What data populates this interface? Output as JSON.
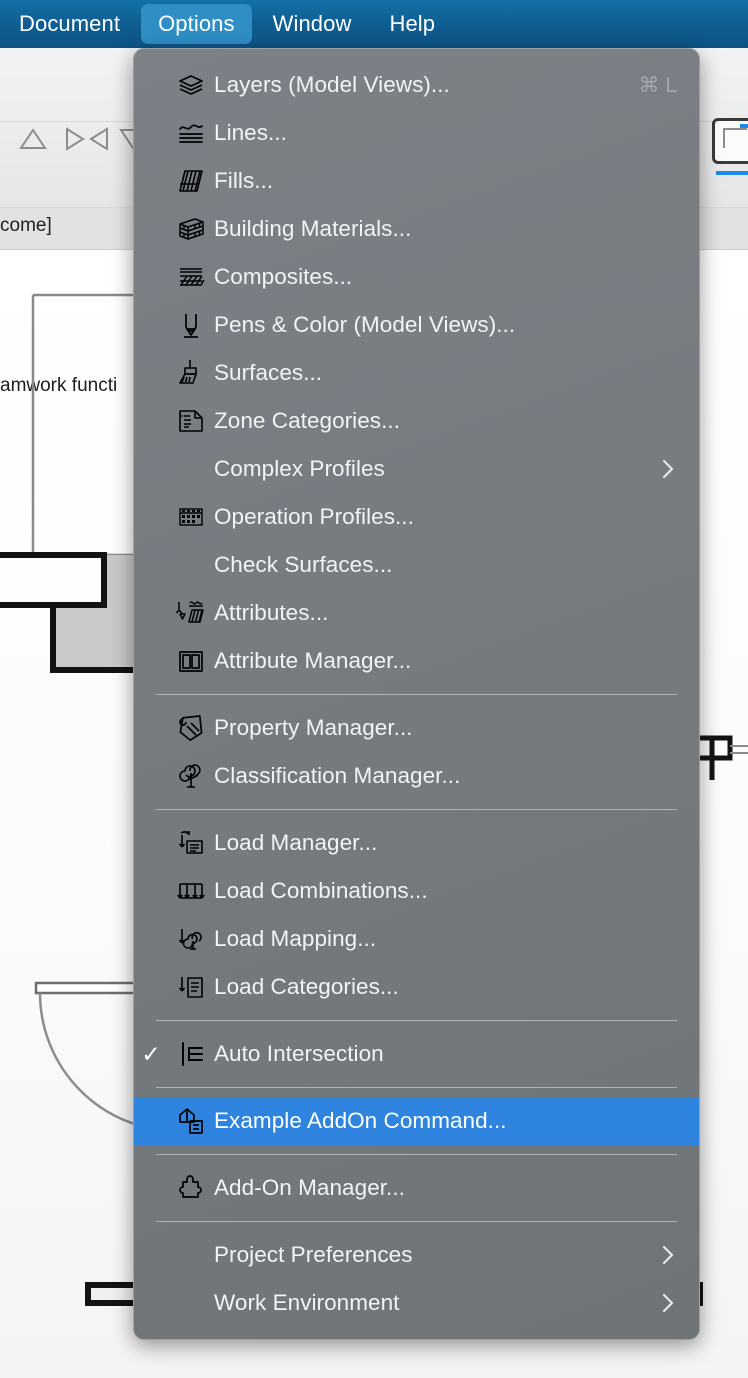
{
  "menubar": {
    "items": [
      {
        "label": "Document",
        "active": false
      },
      {
        "label": "Options",
        "active": true
      },
      {
        "label": "Window",
        "active": false
      },
      {
        "label": "Help",
        "active": false
      }
    ]
  },
  "background": {
    "tab_label": "come]",
    "document_text": "amwork functi",
    "toolbar_icons": [
      "triangle-up-icon",
      "play-left-right-icon",
      "triangle-down-icon"
    ],
    "right_tool_button": "view-frame-icon",
    "accent_color": "#1b8ae8"
  },
  "menu": {
    "accent_color": "#2f84e0",
    "background_color": "#767c80",
    "groups": [
      {
        "items": [
          {
            "icon": "layers-icon",
            "label": "Layers (Model Views)...",
            "shortcut": "⌘ L",
            "checked": false,
            "submenu": false,
            "selected": false
          },
          {
            "icon": "lines-icon",
            "label": "Lines...",
            "shortcut": "",
            "checked": false,
            "submenu": false,
            "selected": false
          },
          {
            "icon": "fills-icon",
            "label": "Fills...",
            "shortcut": "",
            "checked": false,
            "submenu": false,
            "selected": false
          },
          {
            "icon": "building-materials-icon",
            "label": "Building Materials...",
            "shortcut": "",
            "checked": false,
            "submenu": false,
            "selected": false
          },
          {
            "icon": "composites-icon",
            "label": "Composites...",
            "shortcut": "",
            "checked": false,
            "submenu": false,
            "selected": false
          },
          {
            "icon": "pen-icon",
            "label": "Pens & Color (Model Views)...",
            "shortcut": "",
            "checked": false,
            "submenu": false,
            "selected": false
          },
          {
            "icon": "surfaces-brush-icon",
            "label": "Surfaces...",
            "shortcut": "",
            "checked": false,
            "submenu": false,
            "selected": false
          },
          {
            "icon": "zone-categories-icon",
            "label": "Zone Categories...",
            "shortcut": "",
            "checked": false,
            "submenu": false,
            "selected": false
          },
          {
            "icon": "",
            "label": "Complex Profiles",
            "shortcut": "",
            "checked": false,
            "submenu": true,
            "selected": false
          },
          {
            "icon": "operation-profiles-icon",
            "label": "Operation Profiles...",
            "shortcut": "",
            "checked": false,
            "submenu": false,
            "selected": false
          },
          {
            "icon": "",
            "label": "Check Surfaces...",
            "shortcut": "",
            "checked": false,
            "submenu": false,
            "selected": false
          },
          {
            "icon": "attributes-icon",
            "label": "Attributes...",
            "shortcut": "",
            "checked": false,
            "submenu": false,
            "selected": false
          },
          {
            "icon": "attribute-manager-icon",
            "label": "Attribute Manager...",
            "shortcut": "",
            "checked": false,
            "submenu": false,
            "selected": false
          }
        ]
      },
      {
        "items": [
          {
            "icon": "property-tag-icon",
            "label": "Property Manager...",
            "shortcut": "",
            "checked": false,
            "submenu": false,
            "selected": false
          },
          {
            "icon": "classification-tree-icon",
            "label": "Classification Manager...",
            "shortcut": "",
            "checked": false,
            "submenu": false,
            "selected": false
          }
        ]
      },
      {
        "items": [
          {
            "icon": "load-manager-icon",
            "label": "Load Manager...",
            "shortcut": "",
            "checked": false,
            "submenu": false,
            "selected": false
          },
          {
            "icon": "load-combinations-icon",
            "label": "Load Combinations...",
            "shortcut": "",
            "checked": false,
            "submenu": false,
            "selected": false
          },
          {
            "icon": "load-mapping-icon",
            "label": "Load Mapping...",
            "shortcut": "",
            "checked": false,
            "submenu": false,
            "selected": false
          },
          {
            "icon": "load-categories-icon",
            "label": "Load Categories...",
            "shortcut": "",
            "checked": false,
            "submenu": false,
            "selected": false
          }
        ]
      },
      {
        "items": [
          {
            "icon": "auto-intersection-icon",
            "label": "Auto Intersection",
            "shortcut": "",
            "checked": true,
            "submenu": false,
            "selected": false
          }
        ]
      },
      {
        "items": [
          {
            "icon": "addon-command-icon",
            "label": "Example AddOn Command...",
            "shortcut": "",
            "checked": false,
            "submenu": false,
            "selected": true
          }
        ]
      },
      {
        "items": [
          {
            "icon": "puzzle-icon",
            "label": "Add-On Manager...",
            "shortcut": "",
            "checked": false,
            "submenu": false,
            "selected": false
          }
        ]
      },
      {
        "items": [
          {
            "icon": "",
            "label": "Project Preferences",
            "shortcut": "",
            "checked": false,
            "submenu": true,
            "selected": false
          },
          {
            "icon": "",
            "label": "Work Environment",
            "shortcut": "",
            "checked": false,
            "submenu": true,
            "selected": false
          }
        ]
      }
    ]
  }
}
